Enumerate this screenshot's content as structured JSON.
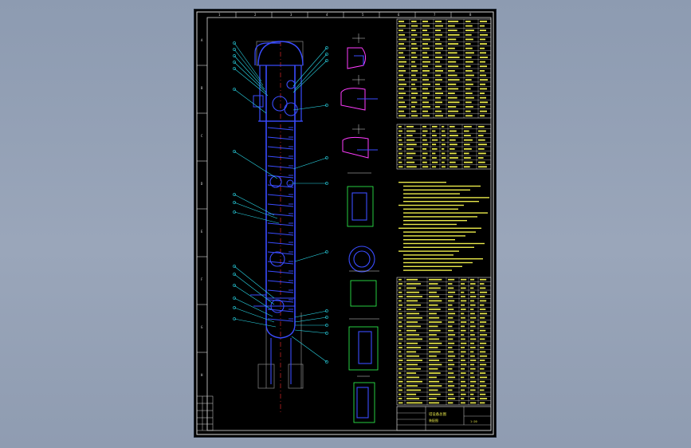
{
  "colors": {
    "background": "#8f9cb1",
    "paper": "#000000",
    "frame": "#d8d8d8",
    "vessel": "#3a4cff",
    "leader": "#2ad8e8",
    "table_text": "#e8e84a",
    "table_line": "#d8d8d8",
    "red_centerline": "#ff3030",
    "magenta": "#ff3cff",
    "green": "#30ff50"
  },
  "sheet": {
    "grid_top": [
      "1",
      "2",
      "3",
      "4",
      "5",
      "6",
      "7",
      "8"
    ],
    "grid_left": [
      "A",
      "B",
      "C",
      "D",
      "E",
      "F",
      "G",
      "H"
    ],
    "title_block": {
      "drawing_name": "塔设备总图",
      "sub_name": "装配图",
      "scale": "1:20"
    }
  }
}
